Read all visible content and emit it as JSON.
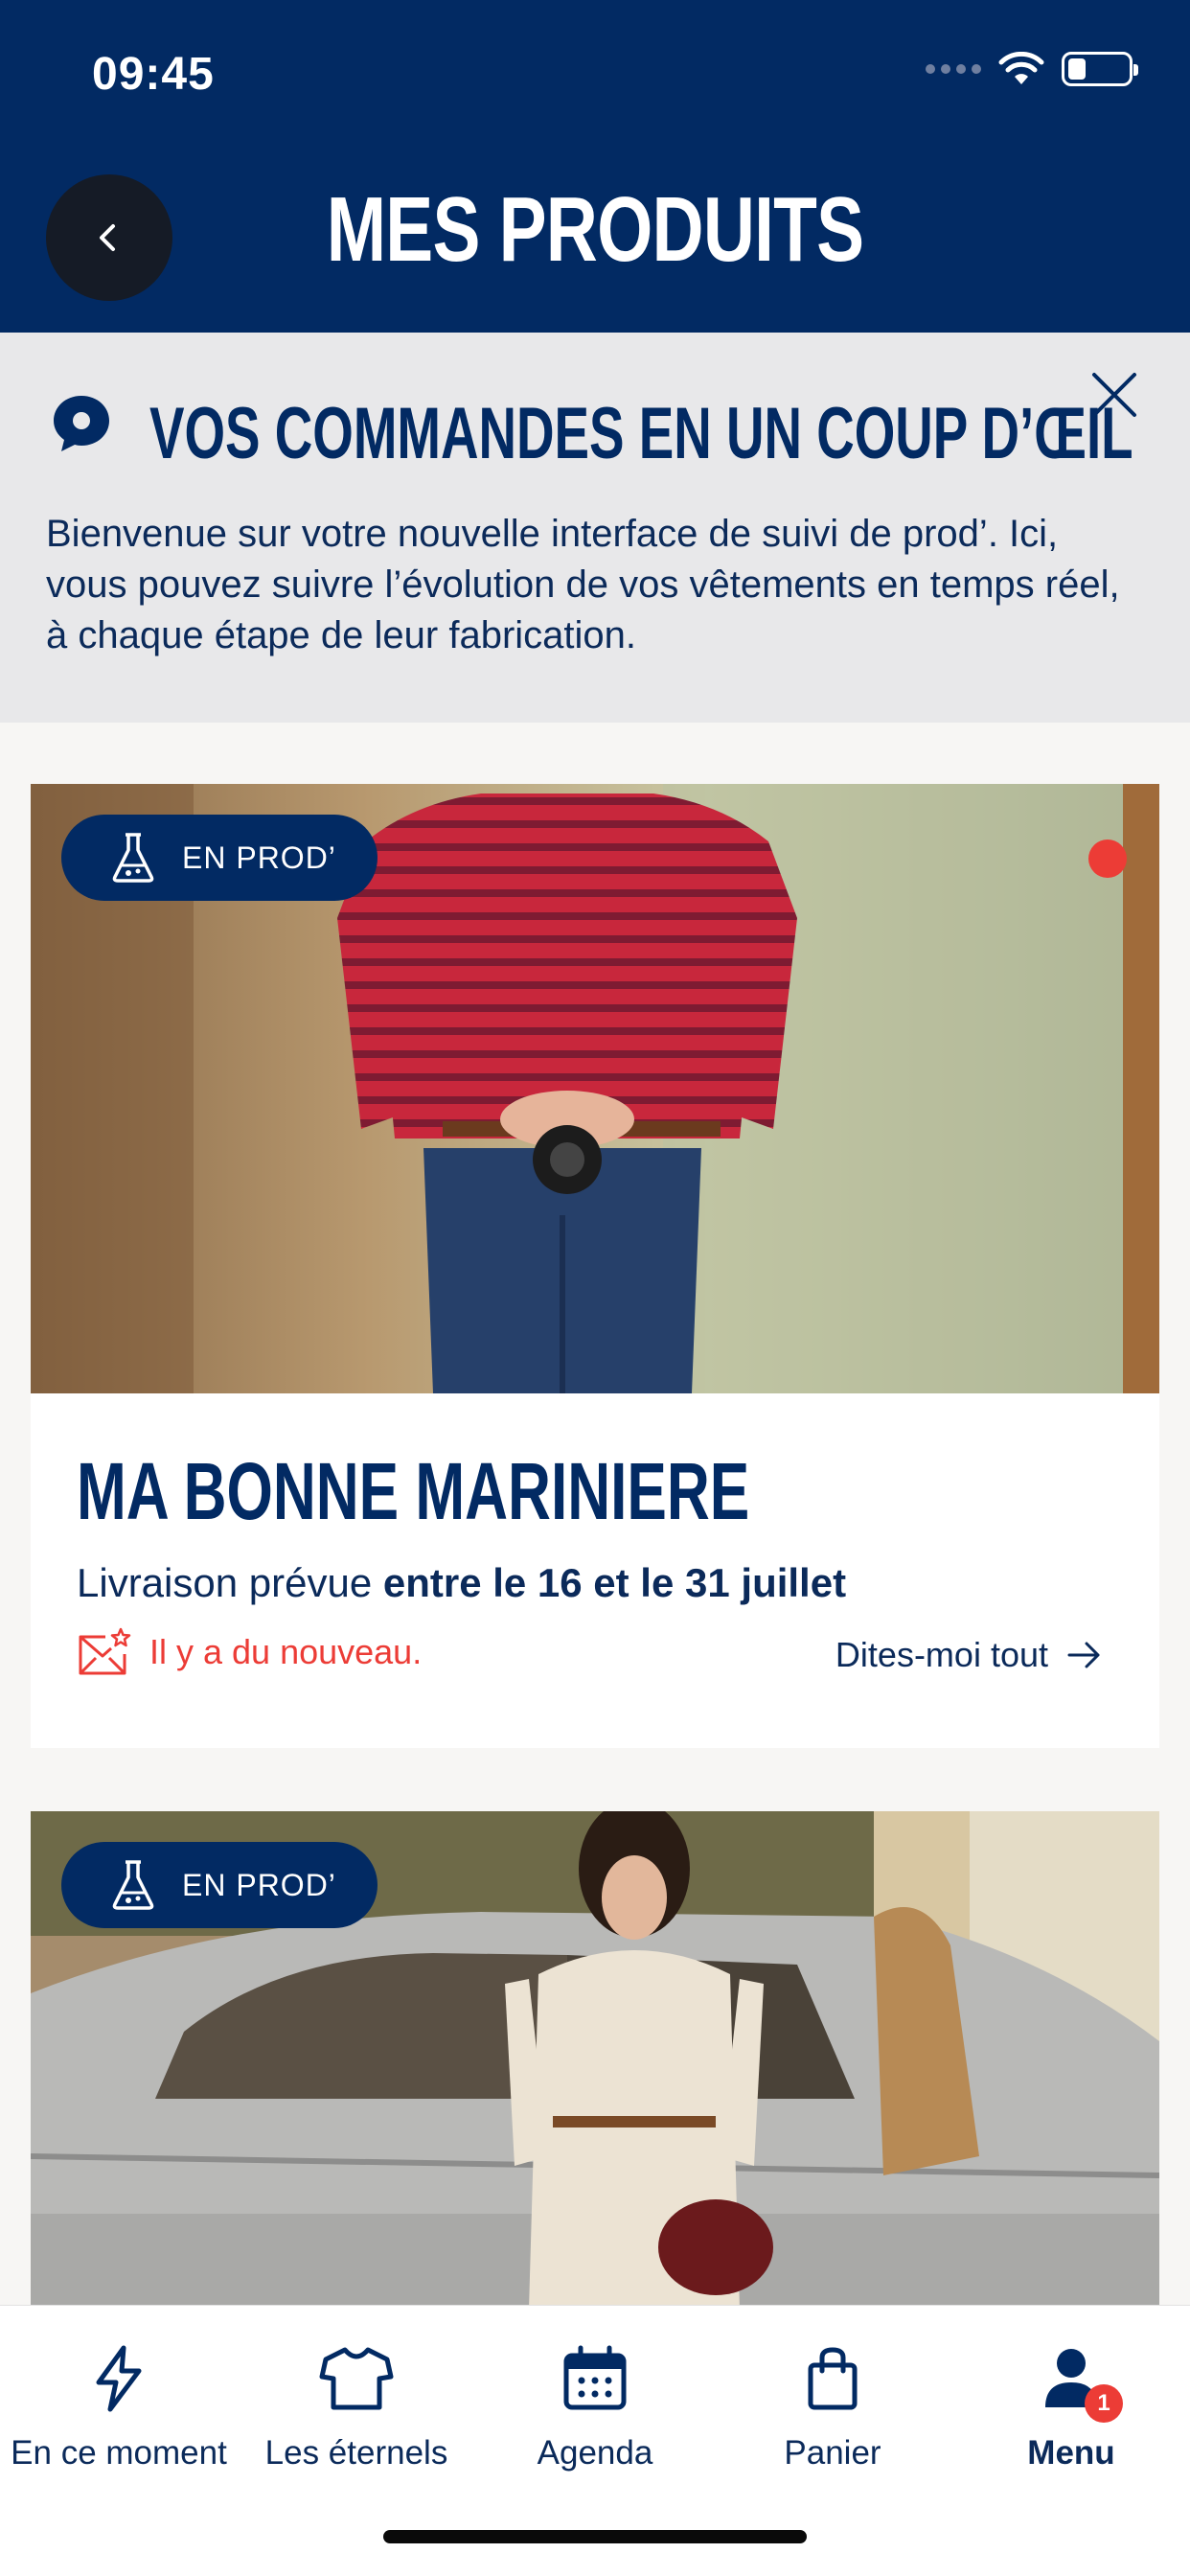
{
  "status": {
    "time": "09:45"
  },
  "header": {
    "title": "MES PRODUITS"
  },
  "banner": {
    "title": "VOS COMMANDES EN UN COUP D’ŒIL",
    "text": "Bienvenue sur votre nouvelle interface de suivi de prod’. Ici, vous pouvez suivre l’évolution de vos vêtements en temps réel, à chaque étape de leur fabrication."
  },
  "cards": [
    {
      "badge": "EN PROD’",
      "name": "MA BONNE MARINIERE",
      "delivery_prefix": "Livraison prévue ",
      "delivery_dates": "entre le 16 et le 31 juillet",
      "news": "Il y a du nouveau.",
      "cta": "Dites-moi tout"
    },
    {
      "badge": "EN PROD’"
    }
  ],
  "tabs": [
    {
      "label": "En ce moment",
      "icon": "lightning-icon"
    },
    {
      "label": "Les éternels",
      "icon": "tshirt-icon"
    },
    {
      "label": "Agenda",
      "icon": "calendar-icon"
    },
    {
      "label": "Panier",
      "icon": "bag-icon"
    },
    {
      "label": "Menu",
      "icon": "user-icon",
      "badge": "1",
      "active": true
    }
  ],
  "colors": {
    "navy": "#022a63",
    "alert_red": "#ec3c36",
    "banner_bg": "#e8e8ea"
  }
}
